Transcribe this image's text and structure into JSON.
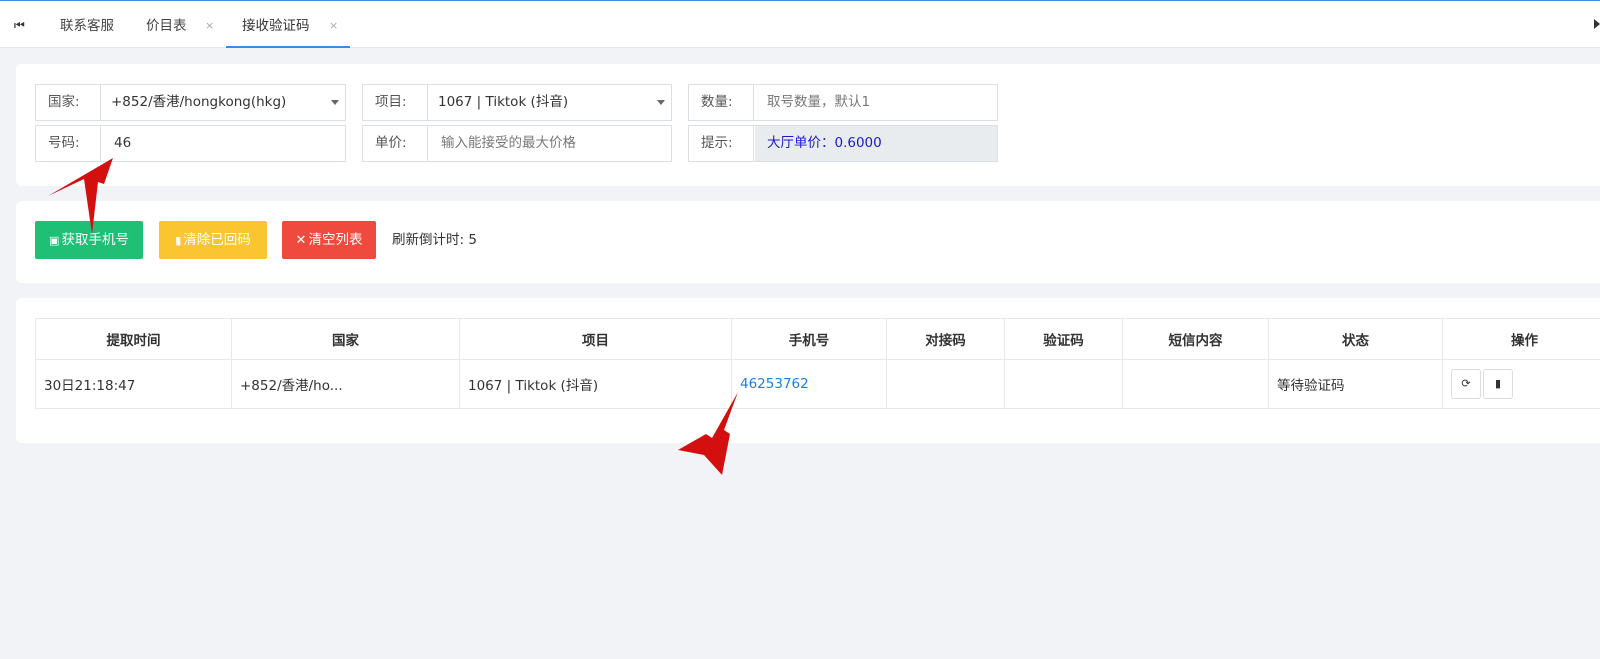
{
  "tabs": [
    {
      "label": "联系客服",
      "closable": false,
      "active": false
    },
    {
      "label": "价目表",
      "closable": true,
      "active": false
    },
    {
      "label": "接收验证码",
      "closable": true,
      "active": true
    }
  ],
  "tab_close_symbol": "×",
  "form": {
    "country": {
      "label": "国家:",
      "value": "+852/香港/hongkong(hkg)"
    },
    "project": {
      "label": "项目:",
      "value": "1067 | Tiktok (抖音)"
    },
    "quantity": {
      "label": "数量:",
      "placeholder": "取号数量，默认1"
    },
    "number": {
      "label": "号码:",
      "value": "46"
    },
    "price": {
      "label": "单价:",
      "placeholder": "输入能接受的最大价格"
    },
    "hint": {
      "label": "提示:",
      "value": "大厅单价：0.6000"
    }
  },
  "actions": {
    "get_phone": "获取手机号",
    "clear_returned": "清除已回码",
    "clear_list": "清空列表",
    "countdown": "刷新倒计时:  5"
  },
  "table": {
    "headers": [
      "提取时间",
      "国家",
      "项目",
      "手机号",
      "对接码",
      "验证码",
      "短信内容",
      "状态",
      "操作"
    ],
    "rows": [
      {
        "time": "30日21:18:47",
        "country": "+852/香港/ho...",
        "project": "1067 | Tiktok (抖音)",
        "phone": "46253762",
        "dock_code": "",
        "code": "",
        "sms": "",
        "status": "等待验证码"
      }
    ]
  },
  "colors": {
    "accent": "#3b8be8",
    "green": "#1fc076",
    "yellow": "#fbc531",
    "red": "#f04a3e",
    "link": "#1e7fe0",
    "arrow": "#d40f0f"
  },
  "icons": [
    "first-page-icon",
    "close-icon",
    "clipboard-icon",
    "file-icon",
    "x-icon",
    "refresh-icon",
    "trash-icon",
    "caret-down-icon"
  ]
}
